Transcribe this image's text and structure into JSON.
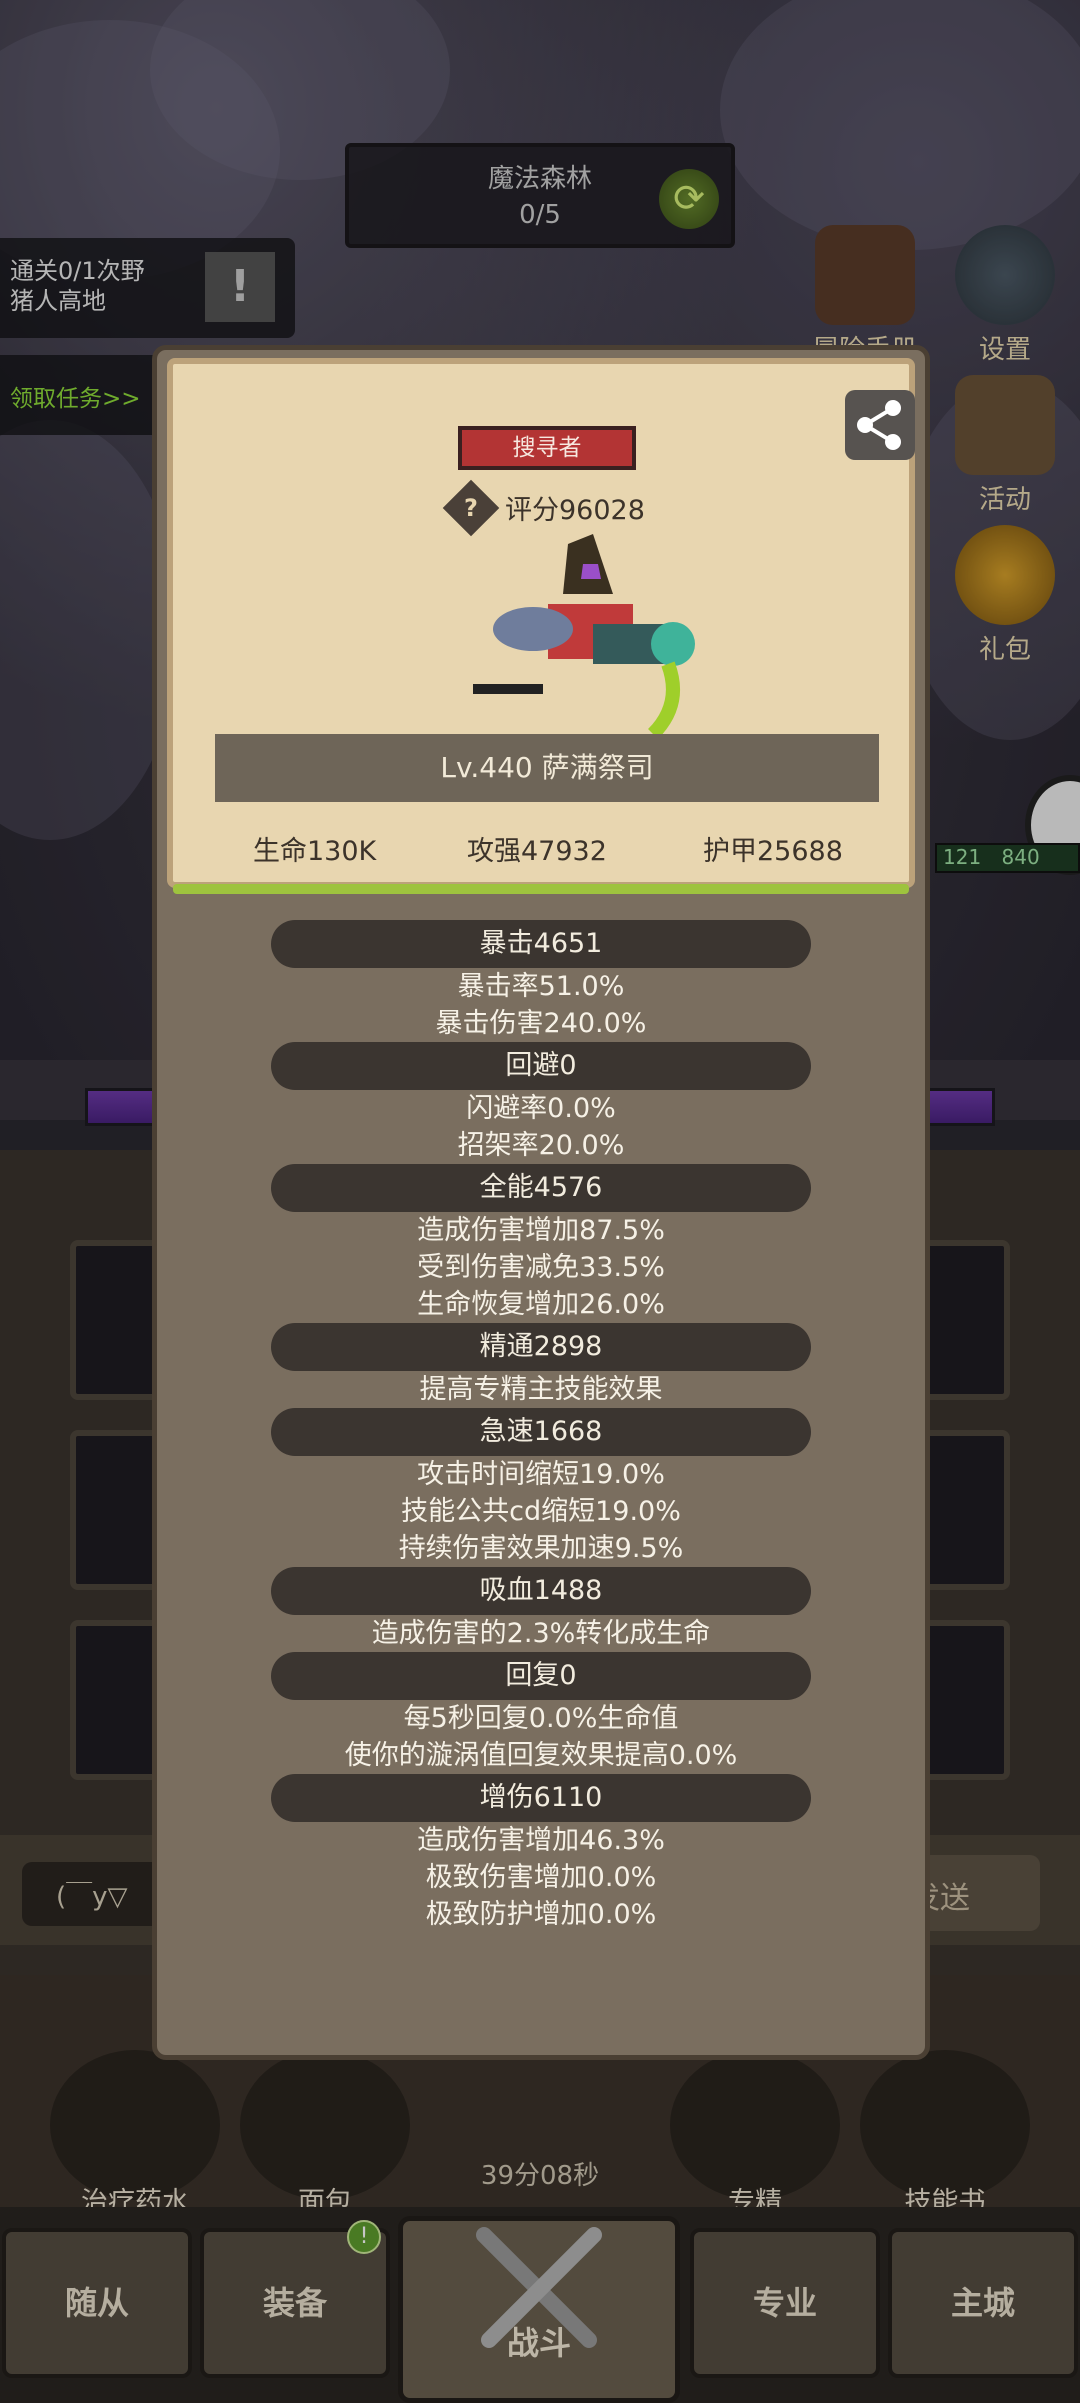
{
  "zone": {
    "name": "魔法森林",
    "progress": "0/5"
  },
  "quest": {
    "text_line1": "通关0/1次野",
    "text_line2": "猪人高地",
    "mark": "!",
    "claim": "领取任务>>"
  },
  "side_menu": [
    {
      "label": "冒险手册",
      "icon": "book-icon"
    },
    {
      "label": "设置",
      "icon": "gear-icon"
    },
    {
      "label": "活动",
      "icon": "scroll-icon"
    },
    {
      "label": "礼包",
      "icon": "gift-icon"
    }
  ],
  "enemy": {
    "level": "121",
    "hp_text": "840"
  },
  "modal": {
    "role": "搜寻者",
    "score_label": "评分96028",
    "help": "?",
    "name_line": "Lv.440 萨满祭司",
    "stats": {
      "hp": "生命130K",
      "attack": "攻强47932",
      "armor": "护甲25688"
    },
    "attributes": [
      {
        "title": "暴击4651",
        "lines": [
          "暴击率51.0%",
          "暴击伤害240.0%"
        ]
      },
      {
        "title": "回避0",
        "lines": [
          "闪避率0.0%",
          "招架率20.0%"
        ]
      },
      {
        "title": "全能4576",
        "lines": [
          "造成伤害增加87.5%",
          "受到伤害减免33.5%",
          "生命恢复增加26.0%"
        ]
      },
      {
        "title": "精通2898",
        "lines": [
          "提高专精主技能效果"
        ]
      },
      {
        "title": "急速1668",
        "lines": [
          "攻击时间缩短19.0%",
          "技能公共cd缩短19.0%",
          "持续伤害效果加速9.5%"
        ]
      },
      {
        "title": "吸血1488",
        "lines": [
          "造成伤害的2.3%转化成生命"
        ]
      },
      {
        "title": "回复0",
        "lines": [
          "每5秒回复0.0%生命值",
          "使你的漩涡值回复效果提高0.0%"
        ]
      },
      {
        "title": "增伤6110",
        "lines": [
          "造成伤害增加46.3%",
          "极致伤害增加0.0%",
          "极致防护增加0.0%"
        ]
      }
    ]
  },
  "chat": {
    "left": "(￣y▽",
    "send": "发送"
  },
  "quick_items": [
    "治疗药水",
    "面包",
    "专精",
    "技能书"
  ],
  "timer": "39分08秒",
  "tabs": {
    "followers": "随从",
    "equipment": "装备",
    "battle": "战斗",
    "profession": "专业",
    "city": "主城",
    "badge": "!"
  },
  "colors": {
    "role_badge": "#b33434",
    "accent_green": "#9ec33e",
    "panel": "#e8d6b0"
  }
}
